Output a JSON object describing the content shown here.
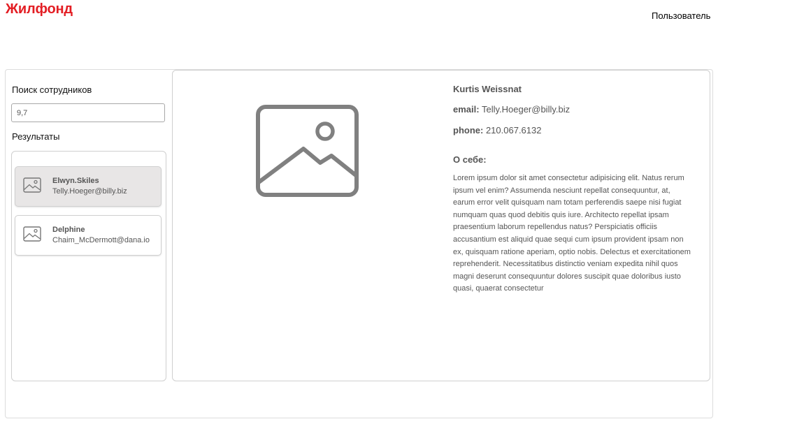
{
  "header": {
    "logo": "Жилфонд",
    "user_link": "Пользователь"
  },
  "sidebar": {
    "search_title": "Поиск сотрудников",
    "search_value": "9,7",
    "results_title": "Результаты",
    "results": [
      {
        "name": "Elwyn.Skiles",
        "email": "Telly.Hoeger@billy.biz",
        "selected": true,
        "icon": "image-placeholder-icon"
      },
      {
        "name": "Delphine",
        "email": "Chaim_McDermott@dana.io",
        "selected": false,
        "icon": "image-placeholder-icon"
      }
    ]
  },
  "detail": {
    "photo_icon": "image-placeholder-icon",
    "name": "Kurtis Weissnat",
    "email_label": "email:",
    "email": "Telly.Hoeger@billy.biz",
    "phone_label": "phone:",
    "phone": "210.067.6132",
    "about_title": "О себе:",
    "about_text": "Lorem ipsum dolor sit amet consectetur adipisicing elit. Natus rerum ipsum vel enim? Assumenda nesciunt repellat consequuntur, at, earum error velit quisquam nam totam perferendis saepe nisi fugiat numquam quas quod debitis quis iure. Architecto repellat ipsam praesentium laborum repellendus natus? Perspiciatis officiis accusantium est aliquid quae sequi cum ipsum provident ipsam non ex, quisquam ratione aperiam, optio nobis. Delectus et exercitationem reprehenderit. Necessitatibus distinctio veniam expedita nihil quos magni deserunt consequuntur dolores suscipit quae doloribus iusto quasi, quaerat consectetur"
  },
  "colors": {
    "brand": "#e31e24",
    "text_muted": "#555555",
    "selected_card": "#e8e6e6",
    "border": "#cfcfcf"
  }
}
